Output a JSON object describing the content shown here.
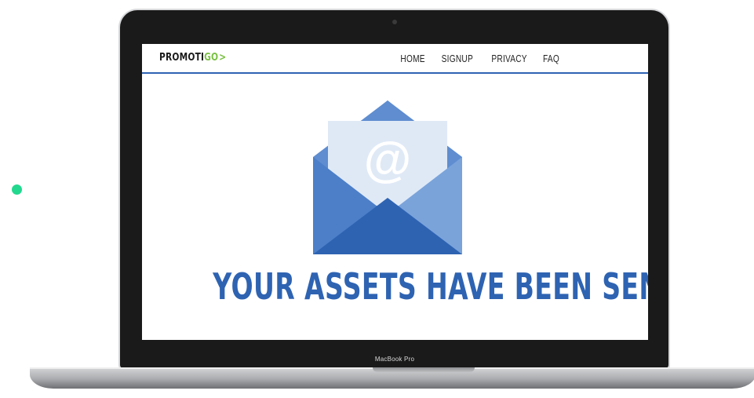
{
  "logo": {
    "part1": "PROMOTI",
    "part2": "GO",
    "arrow": ">"
  },
  "nav": [
    {
      "label": "HOME"
    },
    {
      "label": "SIGNUP"
    },
    {
      "label": "PRIVACY"
    },
    {
      "label": "FAQ"
    }
  ],
  "envelope": {
    "icon": "envelope-icon",
    "symbol": "@"
  },
  "headline": "YOUR ASSETS HAVE BEEN SENT",
  "device": {
    "model_label": "MacBook Pro"
  },
  "colors": {
    "brand_blue": "#2e63b2",
    "brand_green": "#7ac043",
    "dot_green": "#22d88f"
  }
}
